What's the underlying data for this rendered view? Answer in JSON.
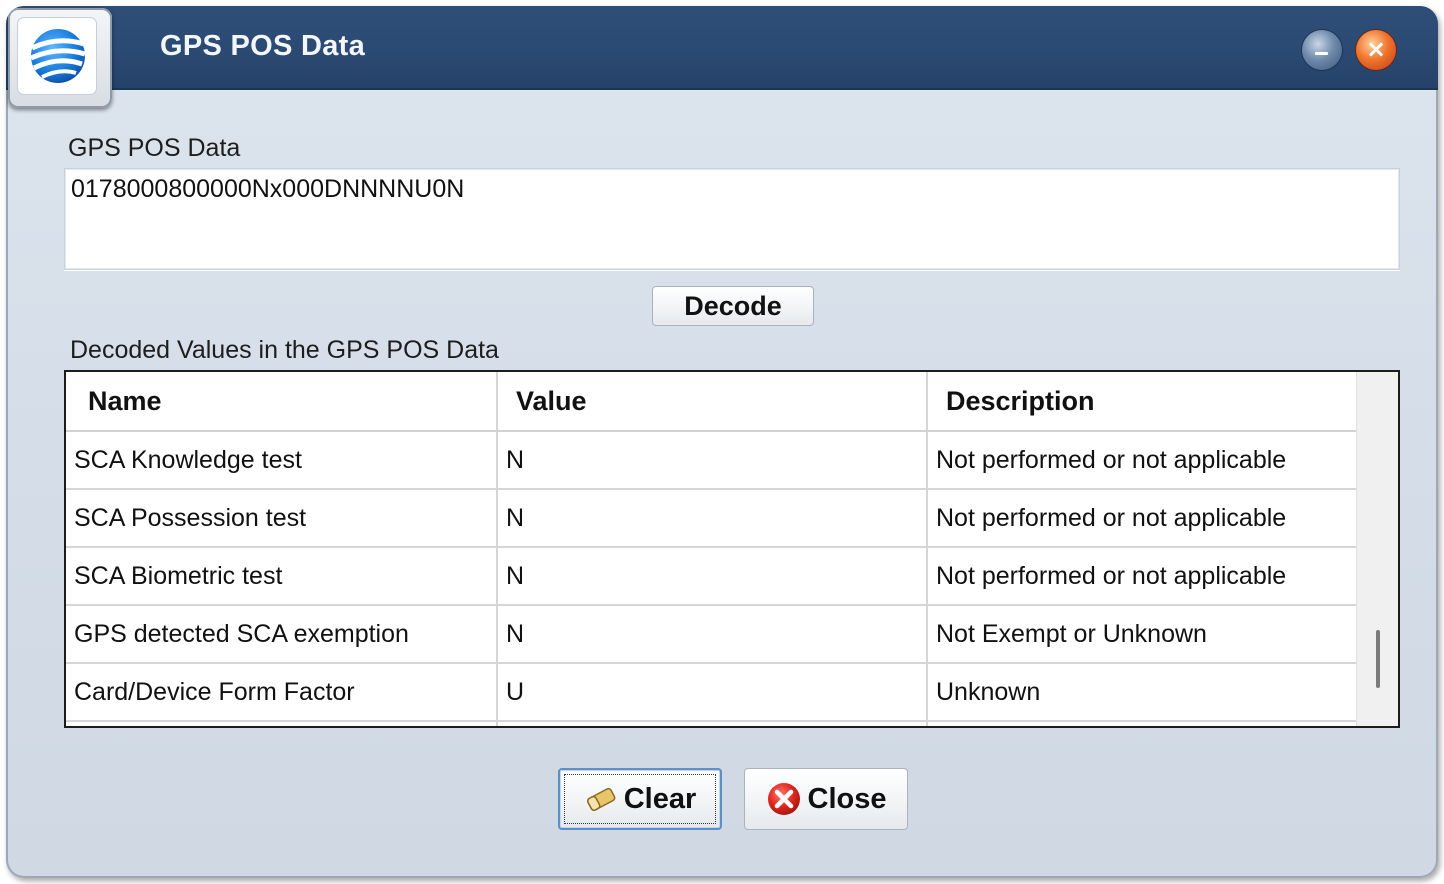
{
  "window": {
    "title": "GPS POS Data",
    "app_icon": "globe-logo-icon",
    "minimize_icon": "minimize-icon",
    "close_icon": "close-icon",
    "close_glyph": "×"
  },
  "form": {
    "pos_label": "GPS POS Data",
    "pos_value": "0178000800000Nx000DNNNNU0N",
    "decode_label": "Decode",
    "decoded_label": "Decoded Values in the GPS POS Data"
  },
  "grid": {
    "columns": [
      "Name",
      "Value",
      "Description"
    ],
    "rows": [
      {
        "name": "SCA Knowledge test",
        "value": "N",
        "description": "Not performed or not applicable"
      },
      {
        "name": "SCA Possession test",
        "value": "N",
        "description": "Not performed or not applicable"
      },
      {
        "name": "SCA Biometric test",
        "value": "N",
        "description": "Not performed or not applicable"
      },
      {
        "name": "GPS detected SCA exemption",
        "value": "N",
        "description": "Not Exempt or Unknown"
      },
      {
        "name": "Card/Device Form Factor",
        "value": "U",
        "description": "Unknown"
      }
    ]
  },
  "actions": {
    "clear_label": "Clear",
    "clear_icon": "eraser-icon",
    "close_label": "Close",
    "close_icon": "red-x-circle-icon"
  },
  "colors": {
    "titlebar": "#2b4a73",
    "window_body": "#d6dee8",
    "close_red": "#e0281f",
    "focus_blue": "#5e8fc4"
  }
}
